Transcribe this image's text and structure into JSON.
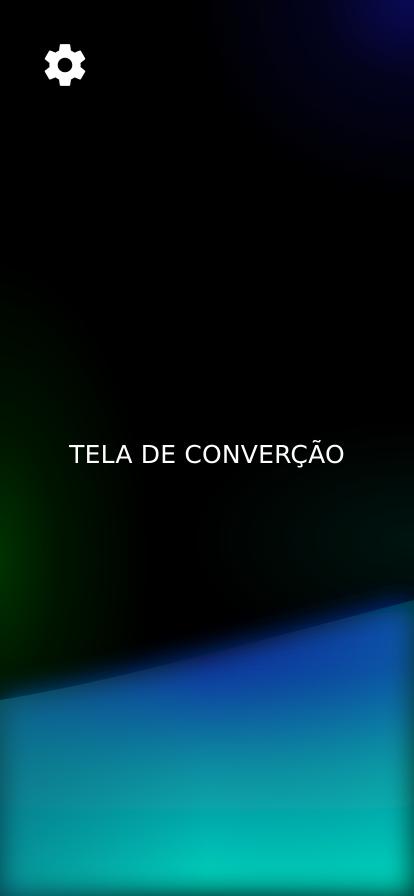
{
  "screen": {
    "title": "TELA DE CONVERÇÃO"
  },
  "header": {
    "settings_icon": "gear-icon"
  },
  "colors": {
    "background": "#000000",
    "text": "#ffffff",
    "accent_blue": "#0a2fa0",
    "accent_teal": "#00d4bb",
    "accent_green": "#003a00"
  }
}
